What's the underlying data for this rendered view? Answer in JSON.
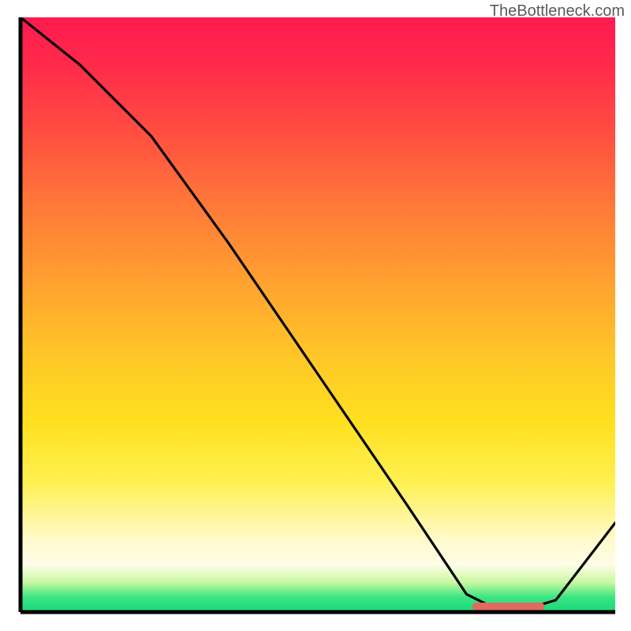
{
  "watermark": "TheBottleneck.com",
  "chart_data": {
    "type": "line",
    "title": "",
    "xlabel": "",
    "ylabel": "",
    "xlim": [
      0,
      100
    ],
    "ylim": [
      0,
      100
    ],
    "series": [
      {
        "name": "bottleneck-curve",
        "x": [
          0,
          10,
          22,
          35,
          50,
          65,
          75,
          80,
          85,
          90,
          100
        ],
        "values": [
          100,
          92,
          80,
          62,
          40,
          18,
          3,
          0.5,
          0.5,
          2,
          15
        ]
      }
    ],
    "annotations": [
      {
        "name": "optimal-range-marker",
        "x_start": 76,
        "x_end": 88,
        "color": "#e2695f"
      }
    ],
    "background_gradient": {
      "stops": [
        {
          "pos": 0,
          "color": "#ff1a4f"
        },
        {
          "pos": 50,
          "color": "#ffb030"
        },
        {
          "pos": 85,
          "color": "#fff860"
        },
        {
          "pos": 100,
          "color": "#1ad87a"
        }
      ]
    }
  }
}
